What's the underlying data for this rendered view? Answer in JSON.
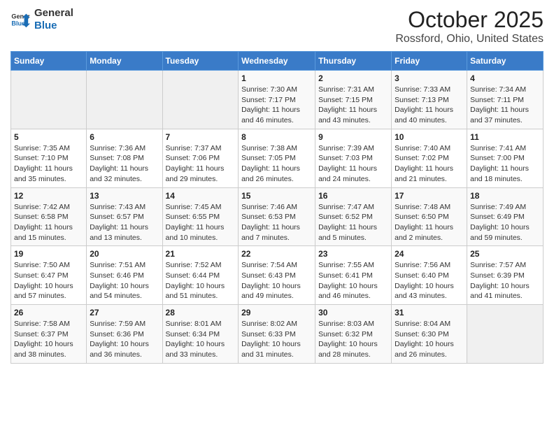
{
  "logo": {
    "text_general": "General",
    "text_blue": "Blue"
  },
  "title": "October 2025",
  "subtitle": "Rossford, Ohio, United States",
  "weekdays": [
    "Sunday",
    "Monday",
    "Tuesday",
    "Wednesday",
    "Thursday",
    "Friday",
    "Saturday"
  ],
  "weeks": [
    [
      {
        "day": "",
        "info": ""
      },
      {
        "day": "",
        "info": ""
      },
      {
        "day": "",
        "info": ""
      },
      {
        "day": "1",
        "info": "Sunrise: 7:30 AM\nSunset: 7:17 PM\nDaylight: 11 hours and 46 minutes."
      },
      {
        "day": "2",
        "info": "Sunrise: 7:31 AM\nSunset: 7:15 PM\nDaylight: 11 hours and 43 minutes."
      },
      {
        "day": "3",
        "info": "Sunrise: 7:33 AM\nSunset: 7:13 PM\nDaylight: 11 hours and 40 minutes."
      },
      {
        "day": "4",
        "info": "Sunrise: 7:34 AM\nSunset: 7:11 PM\nDaylight: 11 hours and 37 minutes."
      }
    ],
    [
      {
        "day": "5",
        "info": "Sunrise: 7:35 AM\nSunset: 7:10 PM\nDaylight: 11 hours and 35 minutes."
      },
      {
        "day": "6",
        "info": "Sunrise: 7:36 AM\nSunset: 7:08 PM\nDaylight: 11 hours and 32 minutes."
      },
      {
        "day": "7",
        "info": "Sunrise: 7:37 AM\nSunset: 7:06 PM\nDaylight: 11 hours and 29 minutes."
      },
      {
        "day": "8",
        "info": "Sunrise: 7:38 AM\nSunset: 7:05 PM\nDaylight: 11 hours and 26 minutes."
      },
      {
        "day": "9",
        "info": "Sunrise: 7:39 AM\nSunset: 7:03 PM\nDaylight: 11 hours and 24 minutes."
      },
      {
        "day": "10",
        "info": "Sunrise: 7:40 AM\nSunset: 7:02 PM\nDaylight: 11 hours and 21 minutes."
      },
      {
        "day": "11",
        "info": "Sunrise: 7:41 AM\nSunset: 7:00 PM\nDaylight: 11 hours and 18 minutes."
      }
    ],
    [
      {
        "day": "12",
        "info": "Sunrise: 7:42 AM\nSunset: 6:58 PM\nDaylight: 11 hours and 15 minutes."
      },
      {
        "day": "13",
        "info": "Sunrise: 7:43 AM\nSunset: 6:57 PM\nDaylight: 11 hours and 13 minutes."
      },
      {
        "day": "14",
        "info": "Sunrise: 7:45 AM\nSunset: 6:55 PM\nDaylight: 11 hours and 10 minutes."
      },
      {
        "day": "15",
        "info": "Sunrise: 7:46 AM\nSunset: 6:53 PM\nDaylight: 11 hours and 7 minutes."
      },
      {
        "day": "16",
        "info": "Sunrise: 7:47 AM\nSunset: 6:52 PM\nDaylight: 11 hours and 5 minutes."
      },
      {
        "day": "17",
        "info": "Sunrise: 7:48 AM\nSunset: 6:50 PM\nDaylight: 11 hours and 2 minutes."
      },
      {
        "day": "18",
        "info": "Sunrise: 7:49 AM\nSunset: 6:49 PM\nDaylight: 10 hours and 59 minutes."
      }
    ],
    [
      {
        "day": "19",
        "info": "Sunrise: 7:50 AM\nSunset: 6:47 PM\nDaylight: 10 hours and 57 minutes."
      },
      {
        "day": "20",
        "info": "Sunrise: 7:51 AM\nSunset: 6:46 PM\nDaylight: 10 hours and 54 minutes."
      },
      {
        "day": "21",
        "info": "Sunrise: 7:52 AM\nSunset: 6:44 PM\nDaylight: 10 hours and 51 minutes."
      },
      {
        "day": "22",
        "info": "Sunrise: 7:54 AM\nSunset: 6:43 PM\nDaylight: 10 hours and 49 minutes."
      },
      {
        "day": "23",
        "info": "Sunrise: 7:55 AM\nSunset: 6:41 PM\nDaylight: 10 hours and 46 minutes."
      },
      {
        "day": "24",
        "info": "Sunrise: 7:56 AM\nSunset: 6:40 PM\nDaylight: 10 hours and 43 minutes."
      },
      {
        "day": "25",
        "info": "Sunrise: 7:57 AM\nSunset: 6:39 PM\nDaylight: 10 hours and 41 minutes."
      }
    ],
    [
      {
        "day": "26",
        "info": "Sunrise: 7:58 AM\nSunset: 6:37 PM\nDaylight: 10 hours and 38 minutes."
      },
      {
        "day": "27",
        "info": "Sunrise: 7:59 AM\nSunset: 6:36 PM\nDaylight: 10 hours and 36 minutes."
      },
      {
        "day": "28",
        "info": "Sunrise: 8:01 AM\nSunset: 6:34 PM\nDaylight: 10 hours and 33 minutes."
      },
      {
        "day": "29",
        "info": "Sunrise: 8:02 AM\nSunset: 6:33 PM\nDaylight: 10 hours and 31 minutes."
      },
      {
        "day": "30",
        "info": "Sunrise: 8:03 AM\nSunset: 6:32 PM\nDaylight: 10 hours and 28 minutes."
      },
      {
        "day": "31",
        "info": "Sunrise: 8:04 AM\nSunset: 6:30 PM\nDaylight: 10 hours and 26 minutes."
      },
      {
        "day": "",
        "info": ""
      }
    ]
  ]
}
